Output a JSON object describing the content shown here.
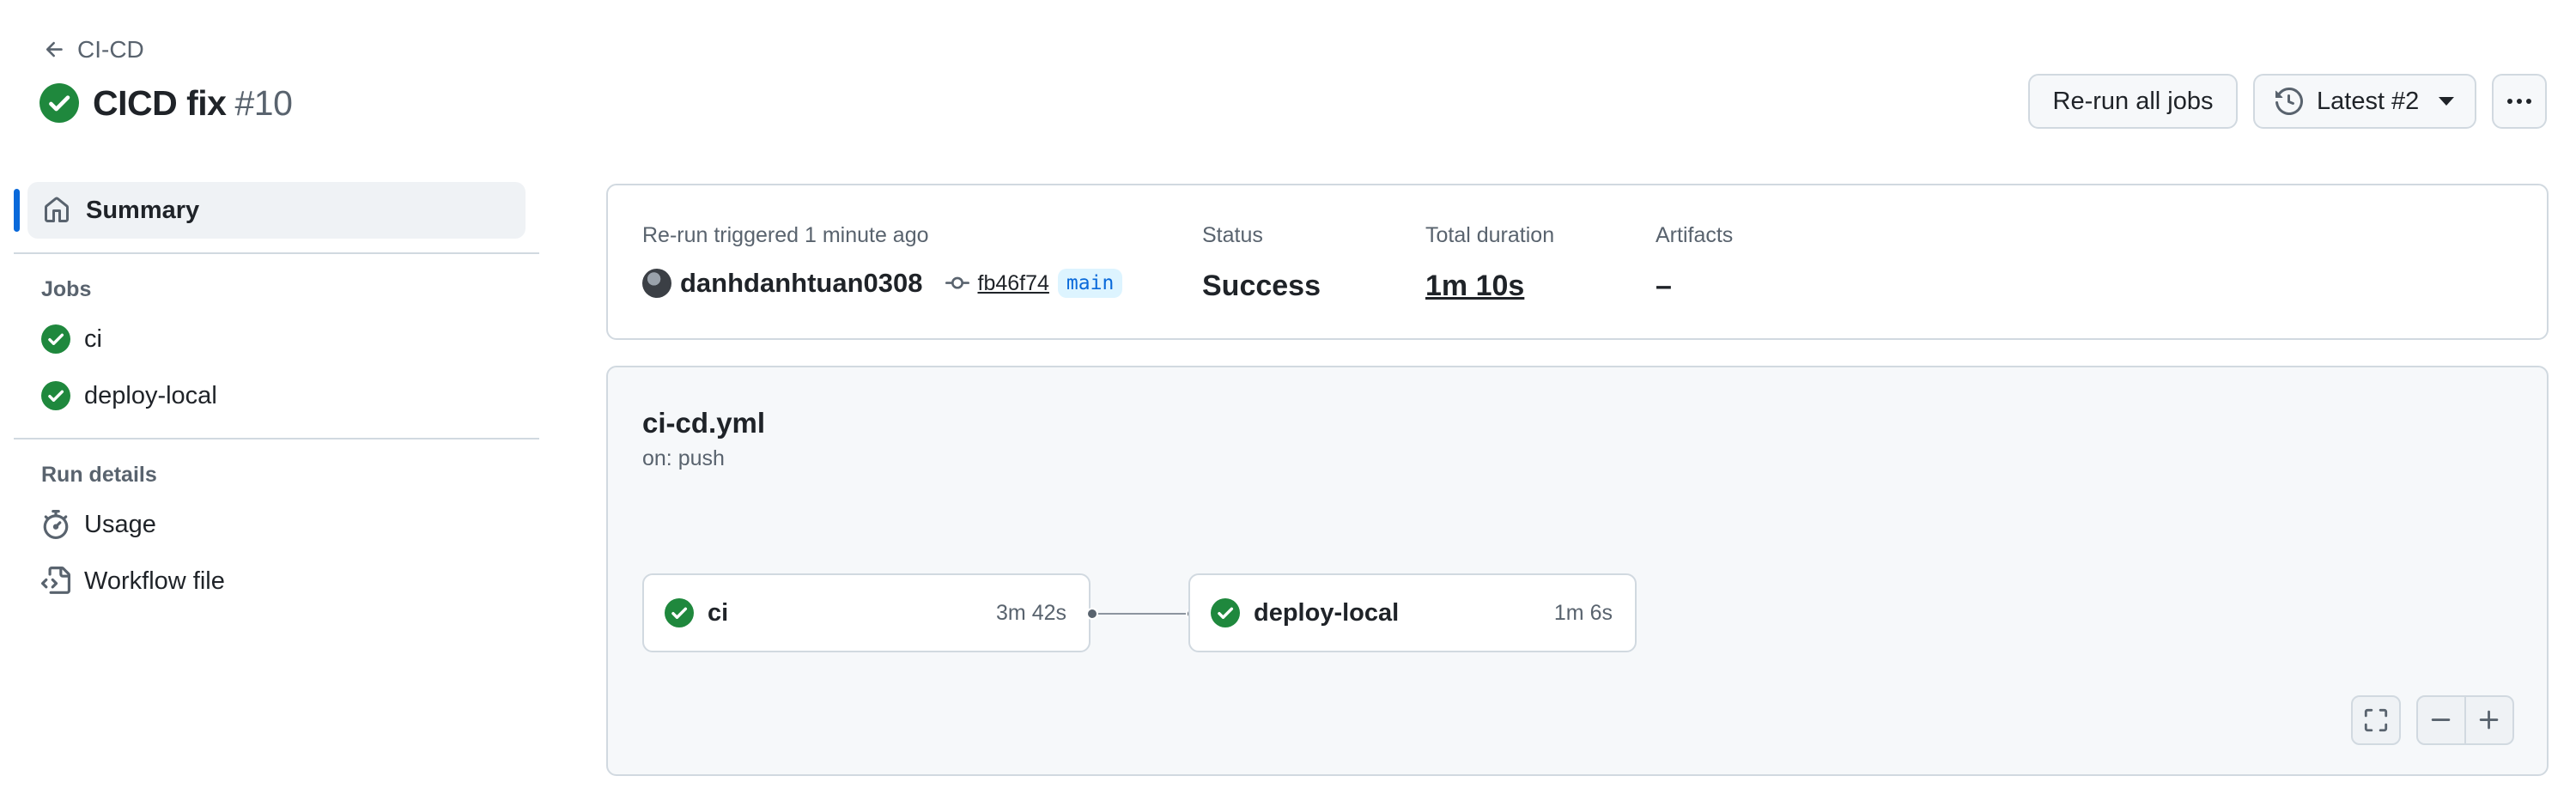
{
  "header": {
    "back_label": "CI-CD",
    "run_title": "CICD fix",
    "run_number": "#10",
    "rerun_button": "Re-run all jobs",
    "attempt_selector": "Latest #2"
  },
  "sidebar": {
    "summary_label": "Summary",
    "jobs_heading": "Jobs",
    "jobs": [
      {
        "label": "ci",
        "status": "success"
      },
      {
        "label": "deploy-local",
        "status": "success"
      }
    ],
    "run_details_heading": "Run details",
    "run_details": [
      {
        "label": "Usage",
        "icon": "stopwatch-icon"
      },
      {
        "label": "Workflow file",
        "icon": "file-code-icon"
      }
    ]
  },
  "summary": {
    "trigger_label": "Re-run triggered 1 minute ago",
    "actor": "danhdanhtuan0308",
    "commit_sha": "fb46f74",
    "branch": "main",
    "status_label": "Status",
    "status_value": "Success",
    "duration_label": "Total duration",
    "duration_value": "1m 10s",
    "artifacts_label": "Artifacts",
    "artifacts_value": "–"
  },
  "graph": {
    "workflow_file": "ci-cd.yml",
    "trigger": "on: push",
    "jobs": [
      {
        "name": "ci",
        "duration": "3m 42s",
        "status": "success"
      },
      {
        "name": "deploy-local",
        "duration": "1m 6s",
        "status": "success"
      }
    ]
  },
  "colors": {
    "success": "#1f883d",
    "accent": "#0969da",
    "border": "#d1d9e0",
    "muted_text": "#59636e"
  }
}
